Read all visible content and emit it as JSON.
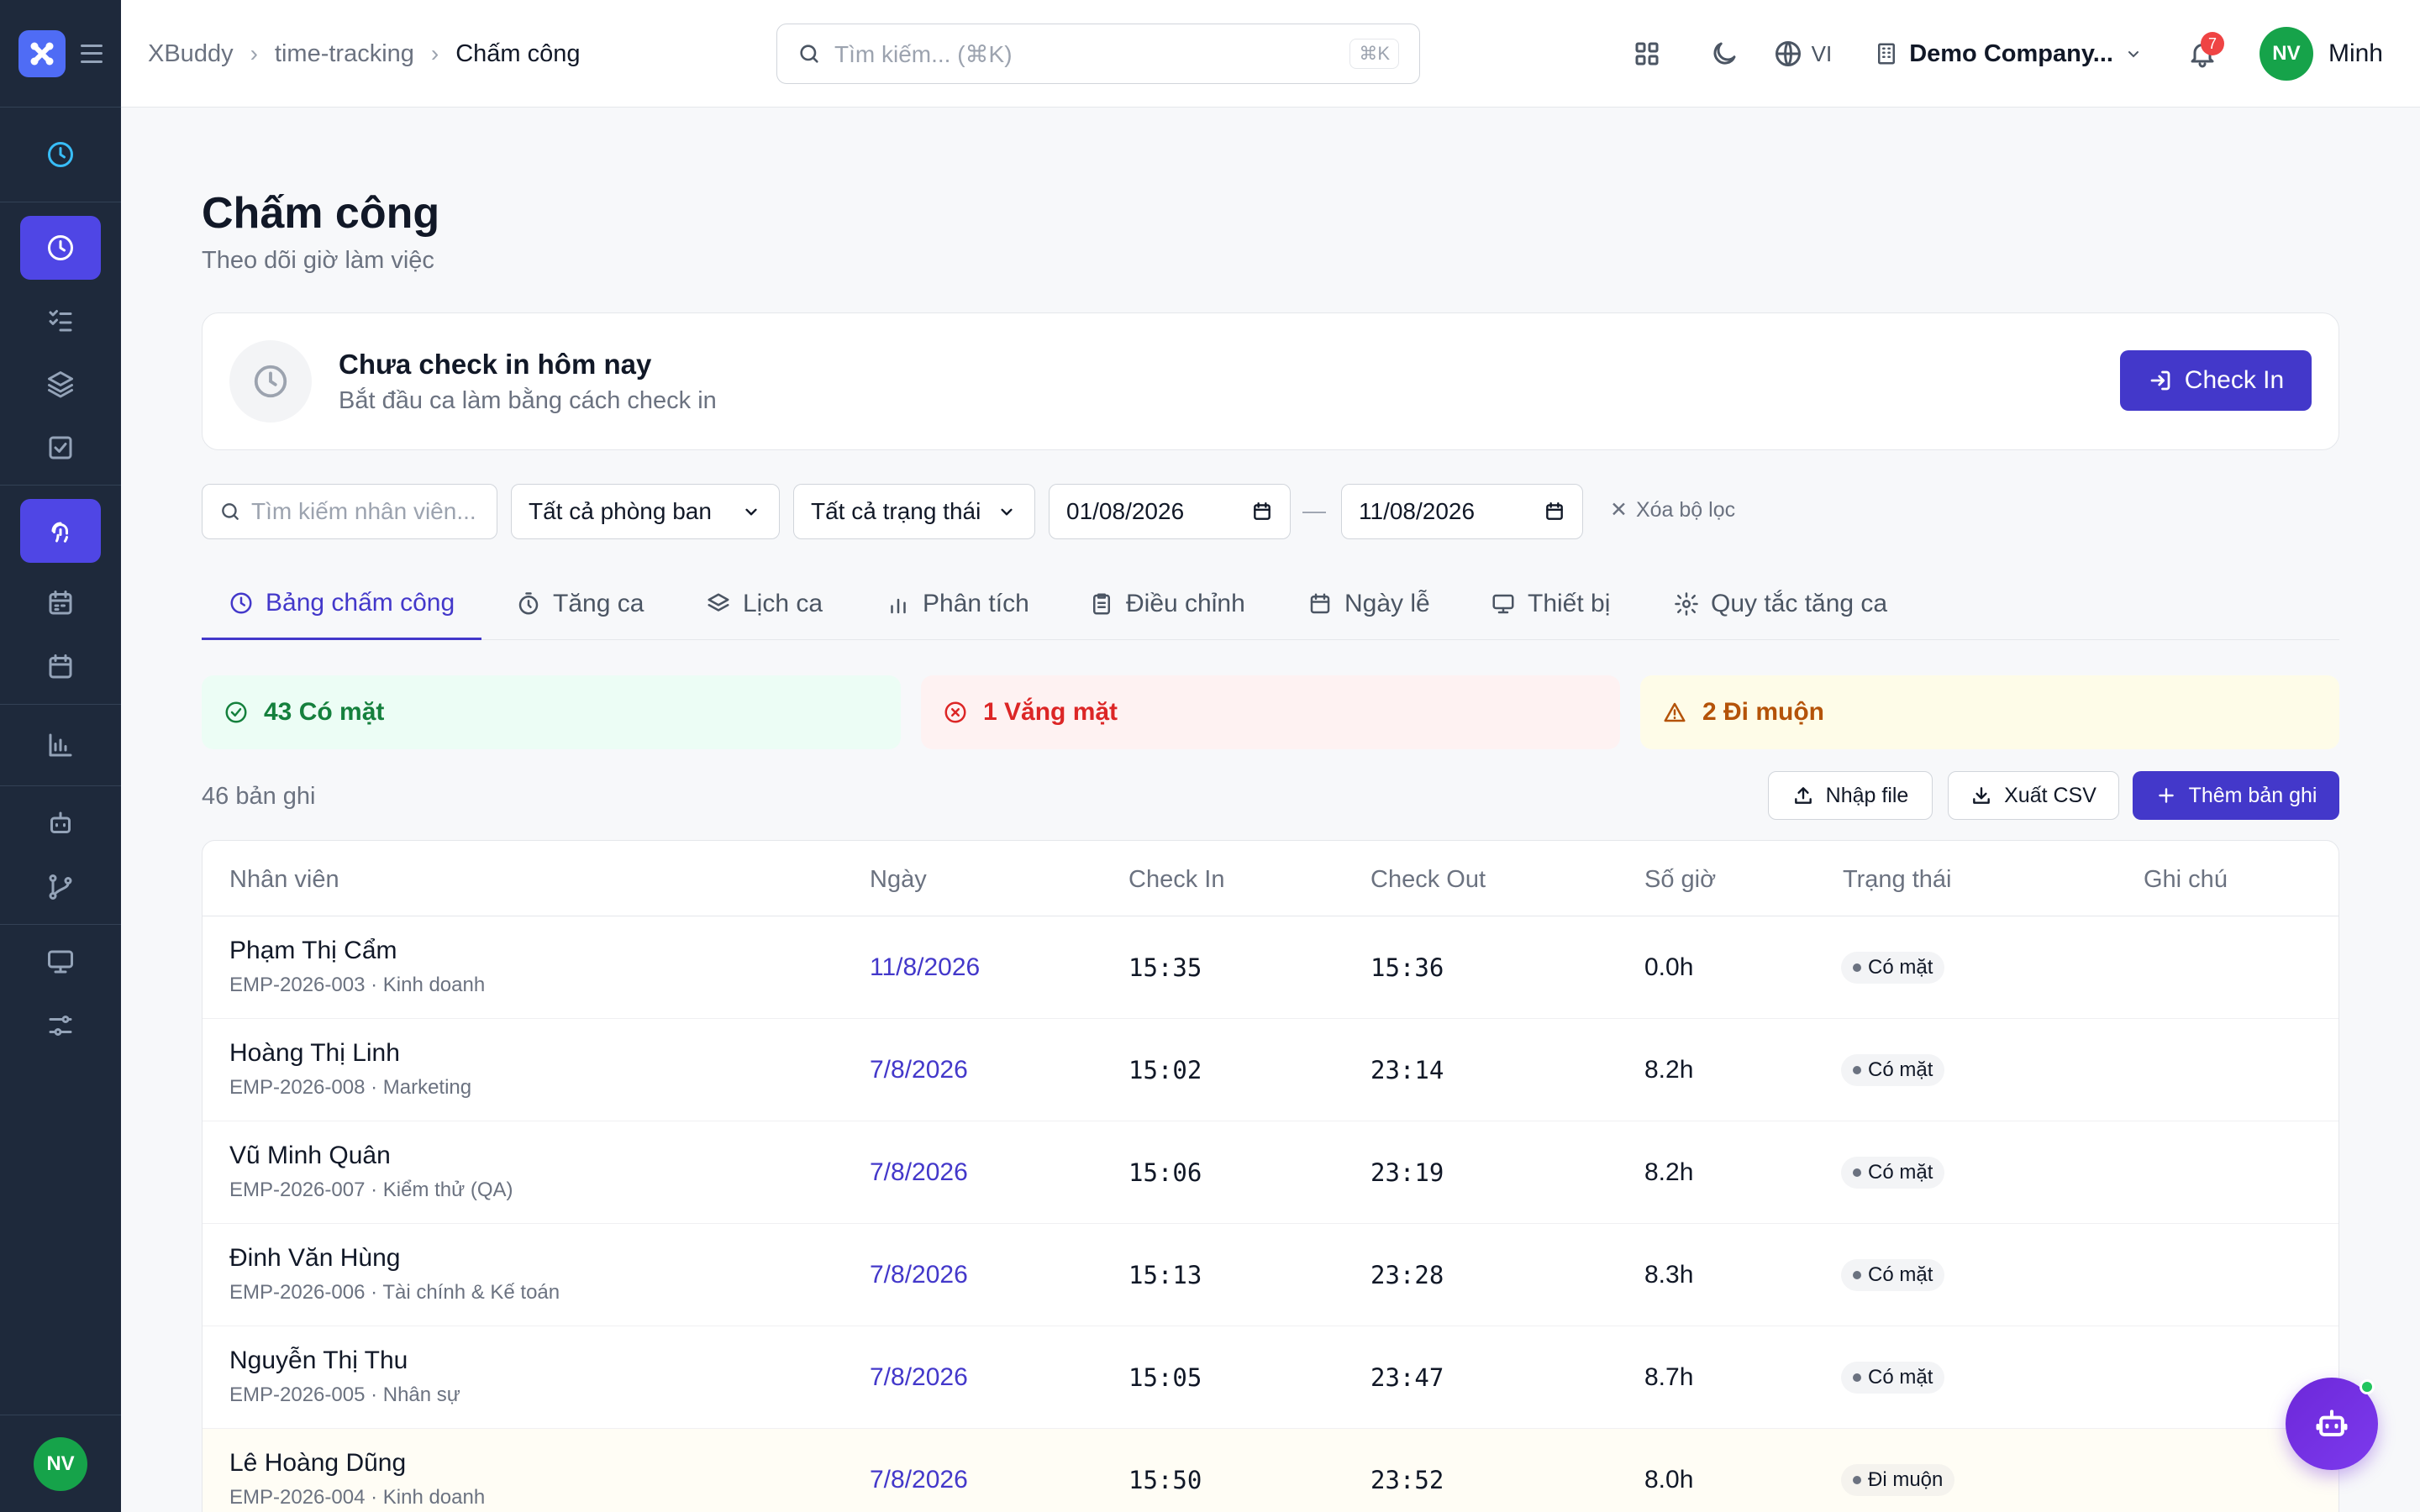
{
  "app": {
    "logo_icon": "xbuddy-logo-icon",
    "accent": "#4338ca"
  },
  "breadcrumb": {
    "items": [
      "XBuddy",
      "time-tracking",
      "Chấm công"
    ]
  },
  "search": {
    "placeholder": "Tìm kiếm... (⌘K)",
    "shortcut": "⌘K"
  },
  "topbar": {
    "lang": "VI",
    "company": "Demo Company...",
    "notification_count": "7",
    "user_initials": "NV",
    "user_name": "Minh"
  },
  "sidebar": {
    "items": [
      {
        "icon": "clock-icon",
        "active": false
      },
      {
        "icon": "clock-icon",
        "active": true
      },
      {
        "icon": "checklist-icon",
        "active": false
      },
      {
        "icon": "layers-icon",
        "active": false
      },
      {
        "icon": "check-square-icon",
        "active": false
      },
      {
        "icon": "fingerprint-icon",
        "active": true
      },
      {
        "icon": "calendar-days-icon",
        "active": false
      },
      {
        "icon": "calendar-icon",
        "active": false
      },
      {
        "icon": "bar-chart-icon",
        "active": false
      },
      {
        "icon": "bot-icon",
        "active": false
      },
      {
        "icon": "git-branch-icon",
        "active": false
      },
      {
        "icon": "monitor-icon",
        "active": false
      },
      {
        "icon": "sliders-icon",
        "active": false
      }
    ],
    "avatar_initials": "NV"
  },
  "page": {
    "title": "Chấm công",
    "subtitle": "Theo dõi giờ làm việc"
  },
  "checkin": {
    "title": "Chưa check in hôm nay",
    "subtitle": "Bắt đầu ca làm bằng cách check in",
    "button": "Check In"
  },
  "filters": {
    "employee_placeholder": "Tìm kiếm nhân viên...",
    "department": "Tất cả phòng ban",
    "status": "Tất cả trạng thái",
    "date_from": "01/08/2026",
    "date_sep": "—",
    "date_to": "11/08/2026",
    "clear": "Xóa bộ lọc"
  },
  "tabs": [
    {
      "label": "Bảng chấm công",
      "icon": "clock-icon",
      "active": true
    },
    {
      "label": "Tăng ca",
      "icon": "timer-icon"
    },
    {
      "label": "Lịch ca",
      "icon": "layers-icon"
    },
    {
      "label": "Phân tích",
      "icon": "bar-chart-icon"
    },
    {
      "label": "Điều chỉnh",
      "icon": "clipboard-icon"
    },
    {
      "label": "Ngày lễ",
      "icon": "calendar-icon"
    },
    {
      "label": "Thiết bị",
      "icon": "monitor-icon"
    },
    {
      "label": "Quy tắc tăng ca",
      "icon": "gear-icon"
    }
  ],
  "stats": {
    "present": "43 Có mặt",
    "absent": "1 Vắng mặt",
    "late": "2 Đi muộn"
  },
  "records": {
    "count": "46 bản ghi",
    "import": "Nhập file",
    "export": "Xuất CSV",
    "add": "Thêm bản ghi"
  },
  "table": {
    "columns": [
      "Nhân viên",
      "Ngày",
      "Check In",
      "Check Out",
      "Số giờ",
      "Trạng thái",
      "Ghi chú"
    ],
    "rows": [
      {
        "name": "Phạm Thị Cẩm",
        "sub": "EMP-2026-003 · Kinh doanh",
        "date": "11/8/2026",
        "in": "15:35",
        "out": "15:36",
        "hours": "0.0h",
        "status": "Có mặt",
        "note": ""
      },
      {
        "name": "Hoàng Thị Linh",
        "sub": "EMP-2026-008 · Marketing",
        "date": "7/8/2026",
        "in": "15:02",
        "out": "23:14",
        "hours": "8.2h",
        "status": "Có mặt",
        "note": ""
      },
      {
        "name": "Vũ Minh Quân",
        "sub": "EMP-2026-007 · Kiểm thử (QA)",
        "date": "7/8/2026",
        "in": "15:06",
        "out": "23:19",
        "hours": "8.2h",
        "status": "Có mặt",
        "note": ""
      },
      {
        "name": "Đinh Văn Hùng",
        "sub": "EMP-2026-006 · Tài chính & Kế toán",
        "date": "7/8/2026",
        "in": "15:13",
        "out": "23:28",
        "hours": "8.3h",
        "status": "Có mặt",
        "note": ""
      },
      {
        "name": "Nguyễn Thị Thu",
        "sub": "EMP-2026-005 · Nhân sự",
        "date": "7/8/2026",
        "in": "15:05",
        "out": "23:47",
        "hours": "8.7h",
        "status": "Có mặt",
        "note": ""
      },
      {
        "name": "Lê Hoàng Dũng",
        "sub": "EMP-2026-004 · Kinh doanh",
        "date": "7/8/2026",
        "in": "15:50",
        "out": "23:52",
        "hours": "8.0h",
        "status": "Đi muộn",
        "note": ""
      }
    ]
  },
  "assistant": {
    "icon": "bot-icon",
    "online": true
  }
}
